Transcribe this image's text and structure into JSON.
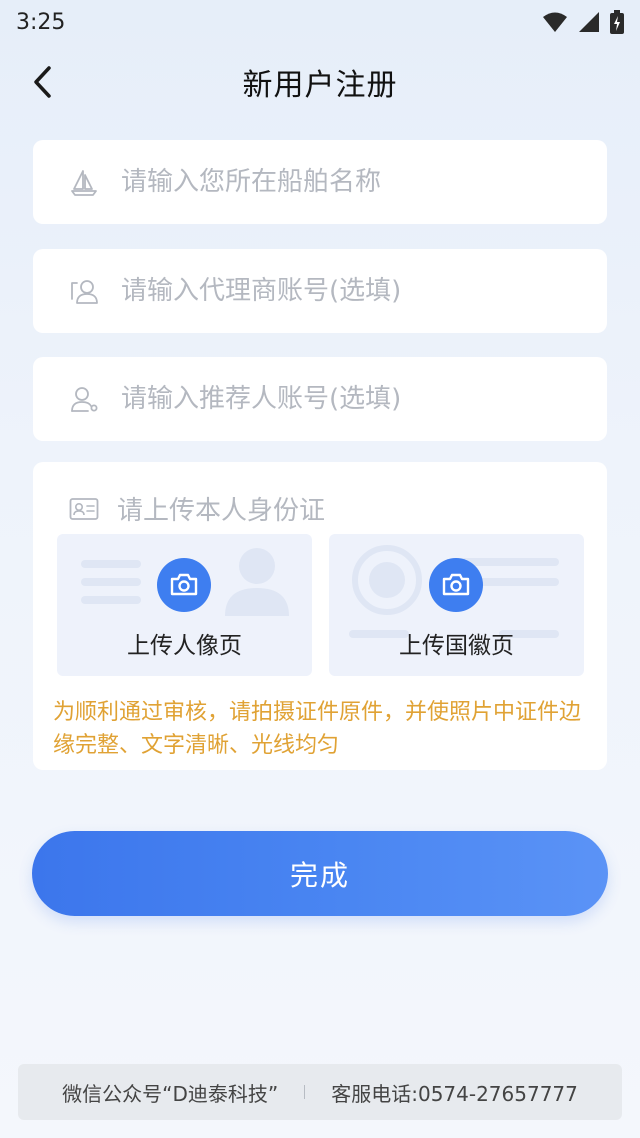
{
  "status_bar": {
    "time": "3:25"
  },
  "nav": {
    "title": "新用户注册"
  },
  "form": {
    "ship_name_placeholder": "请输入您所在船舶名称",
    "agent_account_placeholder": "请输入代理商账号(选填)",
    "referrer_account_placeholder": "请输入推荐人账号(选填)"
  },
  "id_upload": {
    "header": "请上传本人身份证",
    "portrait_label": "上传人像页",
    "emblem_label": "上传国徽页",
    "notice": "为顺利通过审核，请拍摄证件原件，并使照片中证件边缘完整、文字清晰、光线均匀"
  },
  "submit": {
    "label": "完成"
  },
  "footer": {
    "wechat": "微信公众号“D迪泰科技”",
    "service": "客服电话:0574-27657777"
  },
  "colors": {
    "accent": "#3e7ef0",
    "notice": "#e0a234"
  },
  "icons": [
    "back-icon",
    "wifi-icon",
    "signal-icon",
    "battery-icon",
    "boat-icon",
    "agent-icon",
    "referrer-icon",
    "id-card-icon",
    "camera-icon"
  ]
}
